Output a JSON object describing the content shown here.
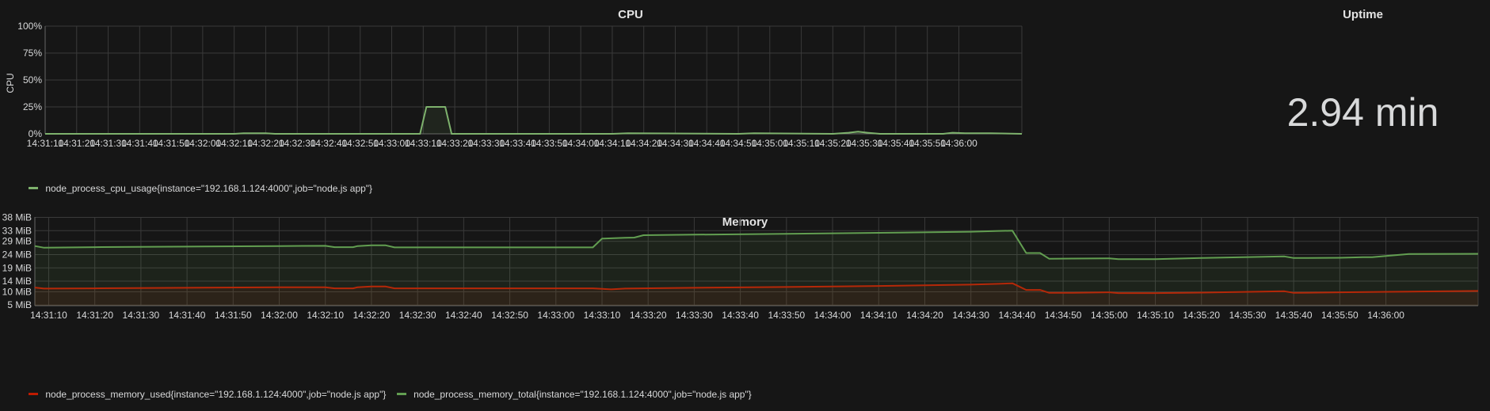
{
  "colors": {
    "cpu": "#7eb26d",
    "mem_used": "#bf1b00",
    "mem_total": "#629e51",
    "grid": "#3a3a3a",
    "text": "#d8d9da"
  },
  "time_labels": [
    "14:31:10",
    "14:31:20",
    "14:31:30",
    "14:31:40",
    "14:31:50",
    "14:32:00",
    "14:32:10",
    "14:32:20",
    "14:32:30",
    "14:32:40",
    "14:32:50",
    "14:33:00",
    "14:33:10",
    "14:33:20",
    "14:33:30",
    "14:33:40",
    "14:33:50",
    "14:34:00",
    "14:34:10",
    "14:34:20",
    "14:34:30",
    "14:34:40",
    "14:34:50",
    "14:35:00",
    "14:35:10",
    "14:35:20",
    "14:35:30",
    "14:35:40",
    "14:35:50",
    "14:36:00"
  ],
  "cpu_panel": {
    "title": "CPU",
    "ylabel": "CPU",
    "legend": "node_process_cpu_usage{instance=\"192.168.1.124:4000\",job=\"node.js app\"}"
  },
  "uptime_panel": {
    "title": "Uptime",
    "value": "2.94 min"
  },
  "memory_panel": {
    "title": "Memory",
    "legend_used": "node_process_memory_used{instance=\"192.168.1.124:4000\",job=\"node.js app\"}",
    "legend_total": "node_process_memory_total{instance=\"192.168.1.124:4000\",job=\"node.js app\"}"
  },
  "chart_data": [
    {
      "type": "area",
      "title": "CPU",
      "ylabel": "CPU",
      "yticks": [
        "0%",
        "25%",
        "50%",
        "75%",
        "100%"
      ],
      "ylim": [
        0,
        100
      ],
      "xlim": [
        "14:31:10",
        "14:36:20"
      ],
      "grid": true,
      "legend_position": "bottom-left",
      "series": [
        {
          "name": "node_process_cpu_usage{instance=\"192.168.1.124:4000\",job=\"node.js app\"}",
          "x": [
            "14:31:10",
            "14:32:10",
            "14:32:13",
            "14:32:20",
            "14:32:23",
            "14:33:09",
            "14:33:11",
            "14:33:14",
            "14:33:15",
            "14:33:17",
            "14:33:19",
            "14:34:10",
            "14:34:15",
            "14:34:50",
            "14:34:55",
            "14:35:20",
            "14:35:25",
            "14:35:28",
            "14:35:31",
            "14:35:35",
            "14:35:55",
            "14:35:58",
            "14:36:02",
            "14:36:05",
            "14:36:10",
            "14:36:20"
          ],
          "values": [
            0,
            0,
            0.5,
            0.5,
            0,
            0,
            25,
            25,
            25,
            25,
            0,
            0,
            0.5,
            0,
            0.5,
            0,
            1,
            2,
            1,
            0,
            0,
            1,
            0.5,
            0.5,
            0.5,
            0
          ]
        }
      ]
    },
    {
      "type": "area",
      "title": "Memory",
      "yticks": [
        "5 MiB",
        "10 MiB",
        "14 MiB",
        "19 MiB",
        "24 MiB",
        "29 MiB",
        "33 MiB",
        "38 MiB"
      ],
      "ylim": [
        4.77,
        38.15
      ],
      "xlim": [
        "14:31:07",
        "14:36:20"
      ],
      "grid": true,
      "legend_position": "bottom-left",
      "series": [
        {
          "name": "node_process_memory_used{instance=\"192.168.1.124:4000\",job=\"node.js app\"}",
          "x": [
            "14:31:07",
            "14:31:09",
            "14:31:20",
            "14:31:40",
            "14:32:00",
            "14:32:10",
            "14:32:12",
            "14:32:16",
            "14:32:17",
            "14:32:20",
            "14:32:23",
            "14:32:25",
            "14:33:08",
            "14:33:12",
            "14:33:15",
            "14:33:30",
            "14:33:50",
            "14:34:10",
            "14:34:30",
            "14:34:36",
            "14:34:39",
            "14:34:42",
            "14:34:45",
            "14:34:47",
            "14:34:52",
            "14:35:00",
            "14:35:02",
            "14:35:10",
            "14:35:20",
            "14:35:38",
            "14:35:40",
            "14:35:50",
            "14:36:00",
            "14:36:20"
          ],
          "values": [
            11.6,
            11.2,
            11.3,
            11.5,
            11.7,
            11.7,
            11.3,
            11.3,
            11.7,
            12.0,
            12.0,
            11.3,
            11.3,
            10.9,
            11.2,
            11.5,
            11.8,
            12.2,
            12.7,
            13.0,
            13.2,
            10.7,
            10.7,
            9.6,
            9.6,
            9.8,
            9.5,
            9.5,
            9.7,
            10.2,
            9.6,
            9.8,
            10.0,
            10.3
          ]
        },
        {
          "name": "node_process_memory_total{instance=\"192.168.1.124:4000\",job=\"node.js app\"}",
          "x": [
            "14:31:07",
            "14:31:09",
            "14:31:20",
            "14:31:40",
            "14:32:00",
            "14:32:10",
            "14:32:12",
            "14:32:16",
            "14:32:17",
            "14:32:20",
            "14:32:23",
            "14:32:25",
            "14:33:08",
            "14:33:10",
            "14:33:15",
            "14:33:17",
            "14:33:19",
            "14:33:30",
            "14:33:50",
            "14:34:10",
            "14:34:30",
            "14:34:36",
            "14:34:39",
            "14:34:42",
            "14:34:45",
            "14:34:47",
            "14:34:52",
            "14:35:00",
            "14:35:02",
            "14:35:10",
            "14:35:20",
            "14:35:38",
            "14:35:40",
            "14:35:50",
            "14:35:55",
            "14:35:57",
            "14:36:05",
            "14:36:20"
          ],
          "values": [
            27.2,
            26.6,
            26.8,
            27.0,
            27.2,
            27.3,
            26.8,
            26.8,
            27.2,
            27.5,
            27.5,
            26.7,
            26.7,
            30.0,
            30.3,
            30.4,
            31.3,
            31.5,
            31.8,
            32.2,
            32.6,
            32.9,
            33.0,
            24.6,
            24.6,
            22.4,
            22.5,
            22.6,
            22.3,
            22.3,
            22.7,
            23.3,
            22.7,
            22.8,
            23.0,
            23.0,
            24.2,
            24.3
          ]
        }
      ]
    }
  ]
}
